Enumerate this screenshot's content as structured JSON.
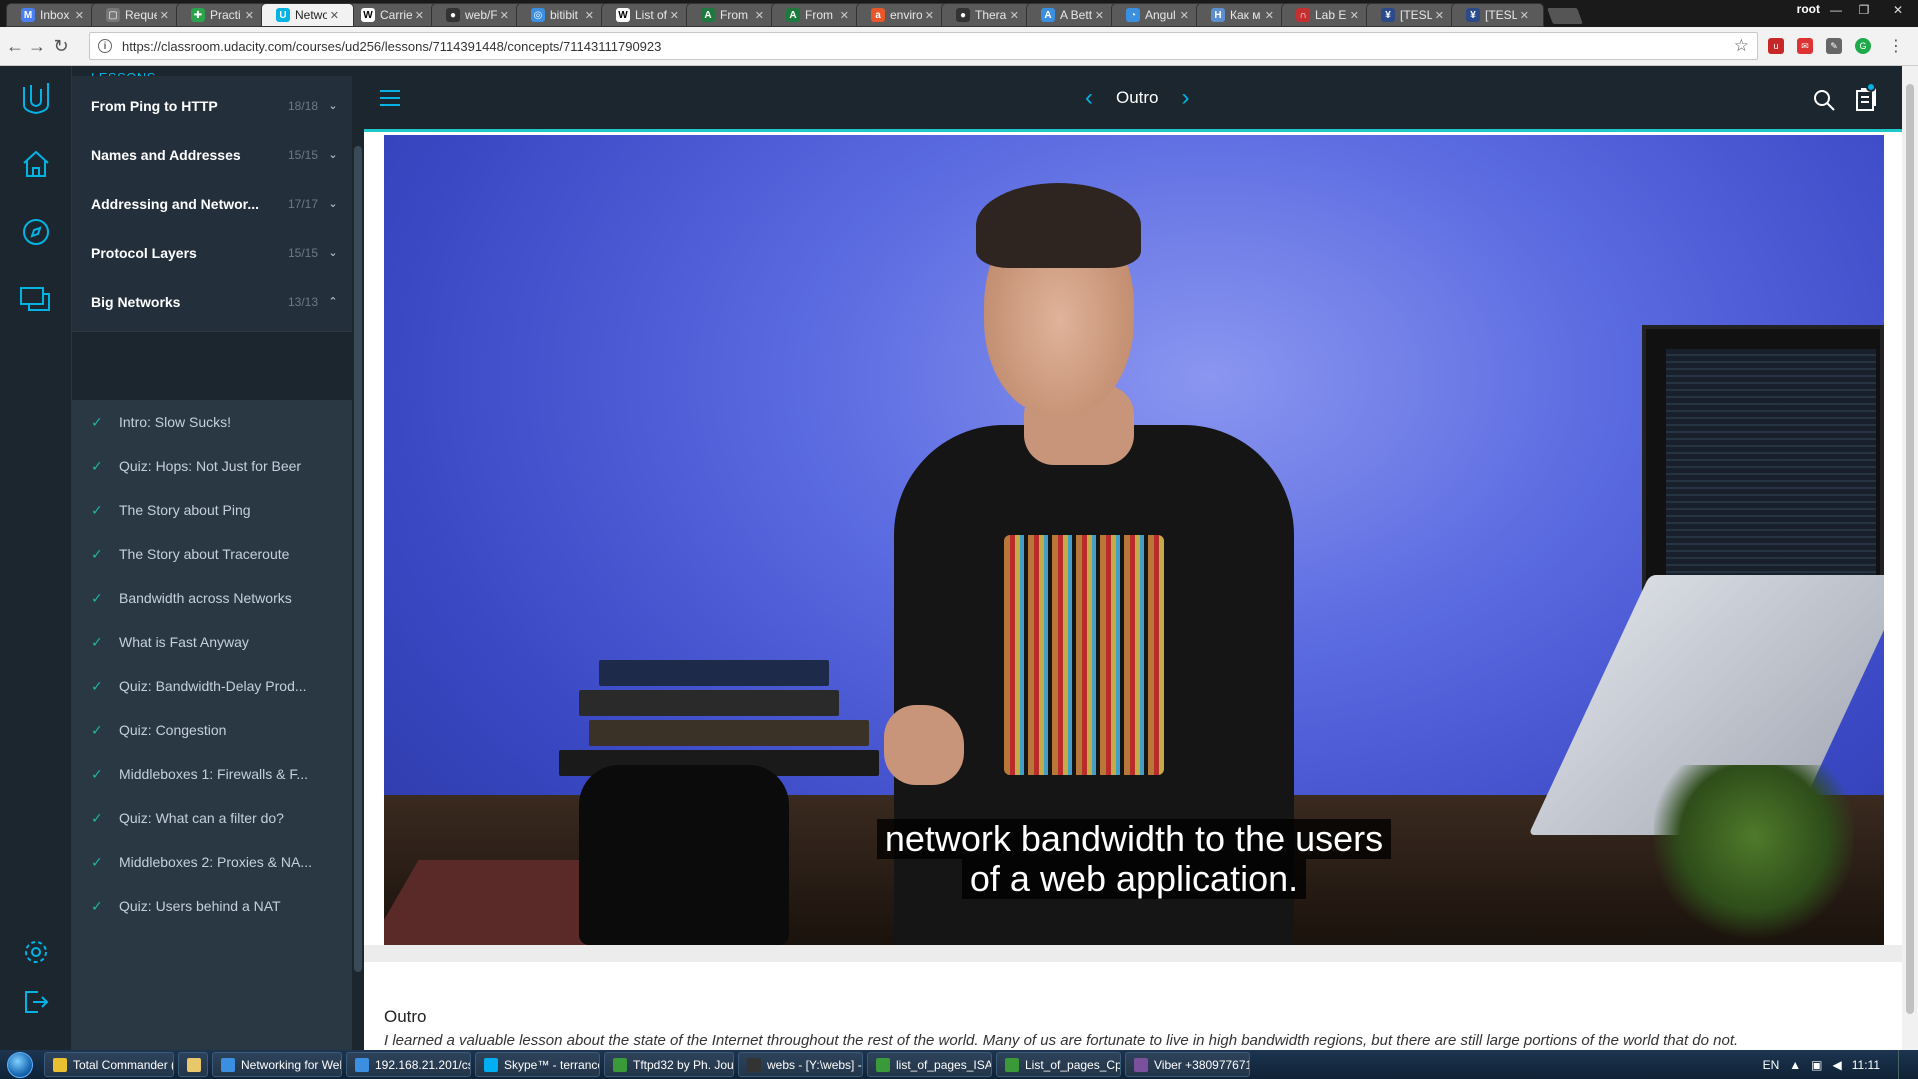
{
  "browser": {
    "tabs": [
      {
        "label": "Inbox",
        "fav_color": "#4a7ff0",
        "fav_glyph": "M"
      },
      {
        "label": "Reque",
        "fav_color": "#777777",
        "fav_glyph": "▢"
      },
      {
        "label": "Practi",
        "fav_color": "#2ba24c",
        "fav_glyph": "✚"
      },
      {
        "label": "Netwo",
        "fav_color": "#02b3e4",
        "fav_glyph": "U",
        "active": true
      },
      {
        "label": "Carrie",
        "fav_color": "#ffffff",
        "fav_glyph": "W"
      },
      {
        "label": "web/F",
        "fav_color": "#333333",
        "fav_glyph": "●"
      },
      {
        "label": "bitibit",
        "fav_color": "#3b8fe0",
        "fav_glyph": "◎"
      },
      {
        "label": "List of",
        "fav_color": "#ffffff",
        "fav_glyph": "W"
      },
      {
        "label": "From",
        "fav_color": "#1e7a3c",
        "fav_glyph": "A"
      },
      {
        "label": "From",
        "fav_color": "#1e7a3c",
        "fav_glyph": "A"
      },
      {
        "label": "enviro",
        "fav_color": "#e8562a",
        "fav_glyph": "a"
      },
      {
        "label": "Thera",
        "fav_color": "#333333",
        "fav_glyph": "●"
      },
      {
        "label": "A Bett",
        "fav_color": "#3b8fe0",
        "fav_glyph": "A"
      },
      {
        "label": "Angul",
        "fav_color": "#3b8fe0",
        "fav_glyph": "◔"
      },
      {
        "label": "Как м",
        "fav_color": "#5b8fd0",
        "fav_glyph": "H"
      },
      {
        "label": "Lab Ei",
        "fav_color": "#c43030",
        "fav_glyph": "∩"
      },
      {
        "label": "[TESL",
        "fav_color": "#2a4a8a",
        "fav_glyph": "¥"
      },
      {
        "label": "[TESL",
        "fav_color": "#2a4a8a",
        "fav_glyph": "¥"
      }
    ],
    "window_user": "root",
    "url": "https://classroom.udacity.com/courses/ud256/lessons/7114391448/concepts/71143111790923"
  },
  "sidebar": {
    "header": "LESSONS",
    "lessons": [
      {
        "name": "From Ping to HTTP",
        "count": "18/18",
        "chevron": "⌄"
      },
      {
        "name": "Names and Addresses",
        "count": "15/15",
        "chevron": "⌄"
      },
      {
        "name": "Addressing and Networ...",
        "count": "17/17",
        "chevron": "⌄"
      },
      {
        "name": "Protocol Layers",
        "count": "15/15",
        "chevron": "⌄"
      },
      {
        "name": "Big Networks",
        "count": "13/13",
        "chevron": "⌃"
      }
    ],
    "concepts": [
      "Intro: Slow Sucks!",
      "Quiz: Hops: Not Just for Beer",
      "The Story about Ping",
      "The Story about Traceroute",
      "Bandwidth across Networks",
      "What is Fast Anyway",
      "Quiz: Bandwidth-Delay Prod...",
      "Quiz: Congestion",
      "Middleboxes 1: Firewalls & F...",
      "Quiz: What can a filter do?",
      "Middleboxes 2: Proxies & NA...",
      "Quiz: Users behind a NAT"
    ],
    "check_glyph": "✓"
  },
  "header": {
    "concept_title": "Outro",
    "prev_glyph": "‹",
    "next_glyph": "›"
  },
  "video": {
    "subtitle_line1": "network bandwidth to the users",
    "subtitle_line2": "of a web application."
  },
  "main": {
    "concept_title": "Outro",
    "body_text": "I learned a valuable lesson about the state of the Internet throughout the rest of the world. Many of us are fortunate to live in high bandwidth regions, but there are still large portions of the world that do not."
  },
  "taskbar": {
    "tasks": [
      {
        "label": "Total Commander (x...",
        "color": "#e8c030"
      },
      {
        "label": "",
        "color": "#e8c86a"
      },
      {
        "label": "Networking for Web ...",
        "color": "#3b8fe0"
      },
      {
        "label": "192.168.21.201/csd6e...",
        "color": "#3b8fe0"
      },
      {
        "label": "Skype™ - terrance256",
        "color": "#00aff0"
      },
      {
        "label": "Tftpd32 by Ph. Jounin",
        "color": "#3a9a3a"
      },
      {
        "label": "webs - [Y:\\webs] - W...",
        "color": "#333333"
      },
      {
        "label": "list_of_pages_ISATAP...",
        "color": "#3a9a3a"
      },
      {
        "label": "List_of_pages_CpStn...",
        "color": "#3a9a3a"
      },
      {
        "label": "Viber +380977671323",
        "color": "#7b519d"
      }
    ],
    "lang": "EN",
    "clock": "11:11"
  },
  "colors": {
    "accent": "#02b3e4",
    "sidebar_bg": "#1c262f",
    "check": "#1fb6a0"
  }
}
